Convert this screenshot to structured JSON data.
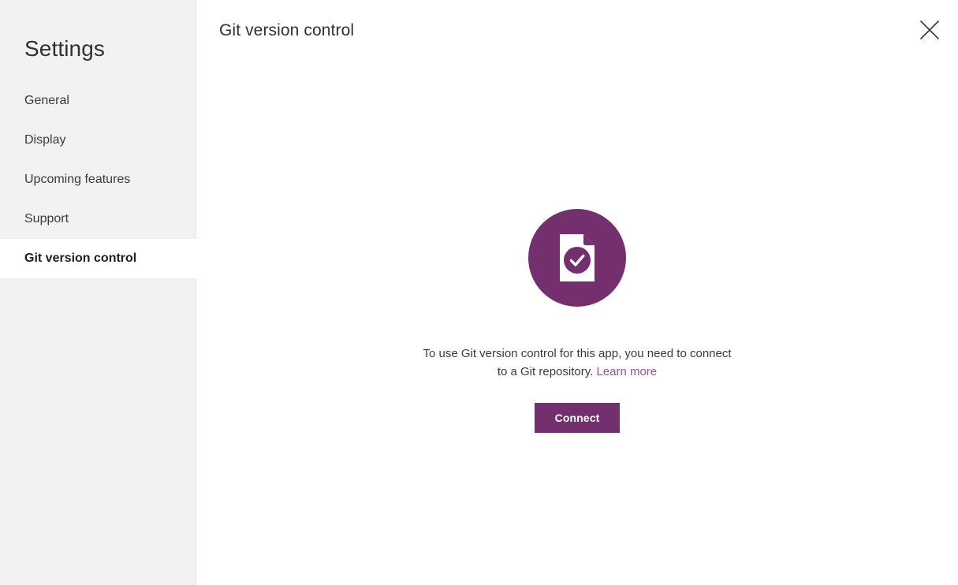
{
  "sidebar": {
    "title": "Settings",
    "items": [
      {
        "label": "General",
        "selected": false
      },
      {
        "label": "Display",
        "selected": false
      },
      {
        "label": "Upcoming features",
        "selected": false
      },
      {
        "label": "Support",
        "selected": false
      },
      {
        "label": "Git version control",
        "selected": true
      }
    ]
  },
  "header": {
    "title": "Git version control",
    "close_icon": "close-icon",
    "close_label": "Close"
  },
  "empty_state": {
    "icon_name": "document-check-circle-icon",
    "message_part1": "To use Git version control for this app, you need to connect to a Git repository. ",
    "link_label": "Learn more",
    "full_message": "To use Git version control for this app, you need to connect to a Git repository. Learn more",
    "button_label": "Connect"
  },
  "colors": {
    "accent_purple": "#74306e",
    "link_purple": "#9e4f96",
    "sidebar_bg": "#f3f2f1",
    "content_bg": "#ffffff",
    "text_primary": "#323130"
  }
}
